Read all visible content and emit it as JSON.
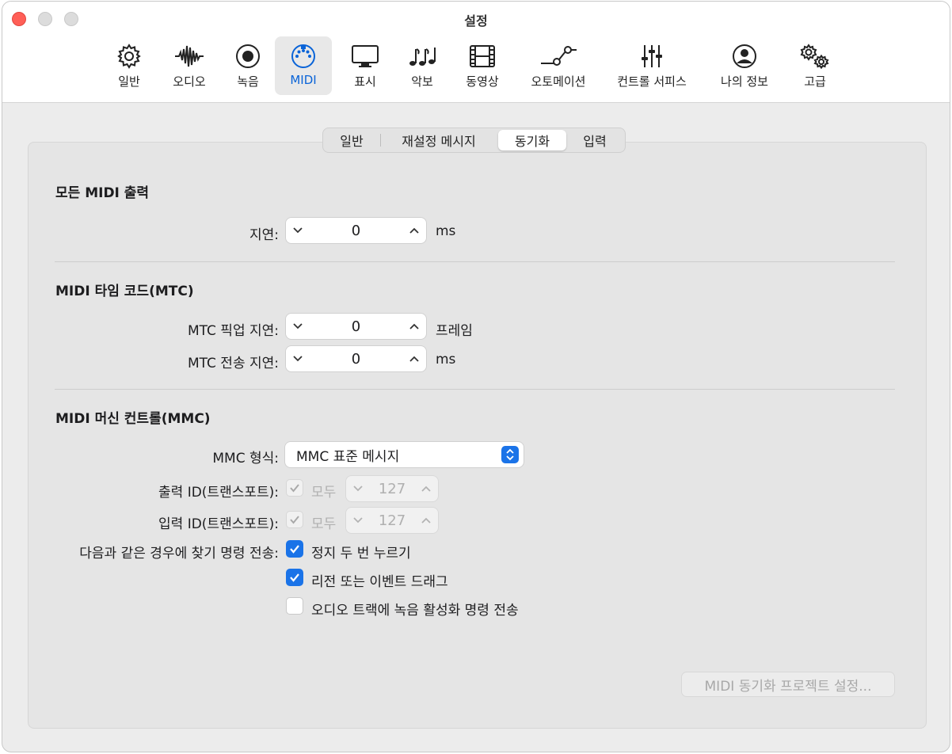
{
  "window": {
    "title": "설정"
  },
  "toolbar": {
    "items": [
      {
        "label": "일반",
        "icon": "gear-icon"
      },
      {
        "label": "오디오",
        "icon": "waveform-icon"
      },
      {
        "label": "녹음",
        "icon": "record-icon"
      },
      {
        "label": "MIDI",
        "icon": "midi-port-icon"
      },
      {
        "label": "표시",
        "icon": "display-icon"
      },
      {
        "label": "악보",
        "icon": "music-notes-icon"
      },
      {
        "label": "동영상",
        "icon": "film-icon"
      },
      {
        "label": "오토메이션",
        "icon": "automation-curve-icon"
      },
      {
        "label": "컨트롤 서피스",
        "icon": "sliders-icon"
      },
      {
        "label": "나의 정보",
        "icon": "person-icon"
      },
      {
        "label": "고급",
        "icon": "gears-icon"
      }
    ],
    "selected": "MIDI",
    "accent": "#0a64d8"
  },
  "tabs": {
    "items": [
      "일반",
      "재설정 메시지",
      "동기화",
      "입력"
    ],
    "selected": "동기화"
  },
  "all_midi_output": {
    "title": "모든 MIDI 출력",
    "delay_label": "지연:",
    "delay_value": "0",
    "delay_unit": "ms"
  },
  "mtc": {
    "title": "MIDI 타임 코드(MTC)",
    "pickup_label": "MTC 픽업 지연:",
    "pickup_value": "0",
    "pickup_unit": "프레임",
    "send_label": "MTC 전송 지연:",
    "send_value": "0",
    "send_unit": "ms"
  },
  "mmc": {
    "title": "MIDI 머신 컨트롤(MMC)",
    "format_label": "MMC 형식:",
    "format_value": "MMC 표준 메시지",
    "output_id_label": "출력 ID(트랜스포트):",
    "output_all_label": "모두",
    "output_id_value": "127",
    "output_all_checked": true,
    "input_id_label": "입력 ID(트랜스포트):",
    "input_all_label": "모두",
    "input_id_value": "127",
    "input_all_checked": true,
    "locate_label": "다음과 같은 경우에 찾기 명령 전송:",
    "options": [
      {
        "label": "정지 두 번 누르기",
        "checked": true
      },
      {
        "label": "리전 또는 이벤트 드래그",
        "checked": true
      },
      {
        "label": "오디오 트랙에 녹음 활성화 명령 전송",
        "checked": false
      }
    ]
  },
  "project_sync_button": "MIDI 동기화 프로젝트 설정..."
}
